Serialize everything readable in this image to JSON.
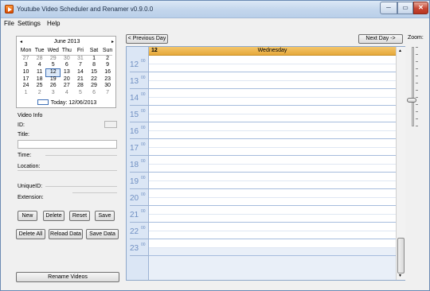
{
  "window": {
    "title": "Youtube Video Scheduler and Renamer v0.9.0.0",
    "min_glyph": "─",
    "max_glyph": "▭",
    "close_glyph": "✕"
  },
  "menu": [
    "File",
    "Settings",
    "Help"
  ],
  "calendar": {
    "prev_glyph": "◂",
    "next_glyph": "▸",
    "month_label": "June 2013",
    "weekdays": [
      "Mon",
      "Tue",
      "Wed",
      "Thu",
      "Fri",
      "Sat",
      "Sun"
    ],
    "weeks": [
      [
        "27",
        "28",
        "29",
        "30",
        "31",
        "1",
        "2"
      ],
      [
        "3",
        "4",
        "5",
        "6",
        "7",
        "8",
        "9"
      ],
      [
        "10",
        "11",
        "12",
        "13",
        "14",
        "15",
        "16"
      ],
      [
        "17",
        "18",
        "19",
        "20",
        "21",
        "22",
        "23"
      ],
      [
        "24",
        "25",
        "26",
        "27",
        "28",
        "29",
        "30"
      ],
      [
        "1",
        "2",
        "3",
        "4",
        "5",
        "6",
        "7"
      ]
    ],
    "selected_day": "12",
    "today_label": "Today: 12/06/2013"
  },
  "video_info": {
    "header": "Video Info",
    "id_label": "ID:",
    "title_label": "Title:",
    "title_value": "",
    "time_label": "Time:",
    "location_label": "Location:",
    "unique_id_label": "UniqueID:",
    "extension_label": "Extension:"
  },
  "buttons": {
    "new": "New",
    "delete": "Delete",
    "reset": "Reset",
    "save": "Save",
    "delete_all": "Delete All",
    "reload_data": "Reload Data",
    "save_data": "Save Data",
    "rename_videos": "Rename Videos"
  },
  "dayview": {
    "previous_day": "< Previous Day",
    "next_day": "Next Day ->",
    "zoom_label": "Zoom:",
    "date_number": "12",
    "day_name": "Wednesday",
    "minutes_label": "00",
    "hours": [
      "12",
      "13",
      "14",
      "15",
      "16",
      "17",
      "18",
      "19",
      "20",
      "21",
      "22",
      "23"
    ],
    "scroll_up_glyph": "▲",
    "scroll_down_glyph": "▼",
    "zoom_level": 0.67
  }
}
